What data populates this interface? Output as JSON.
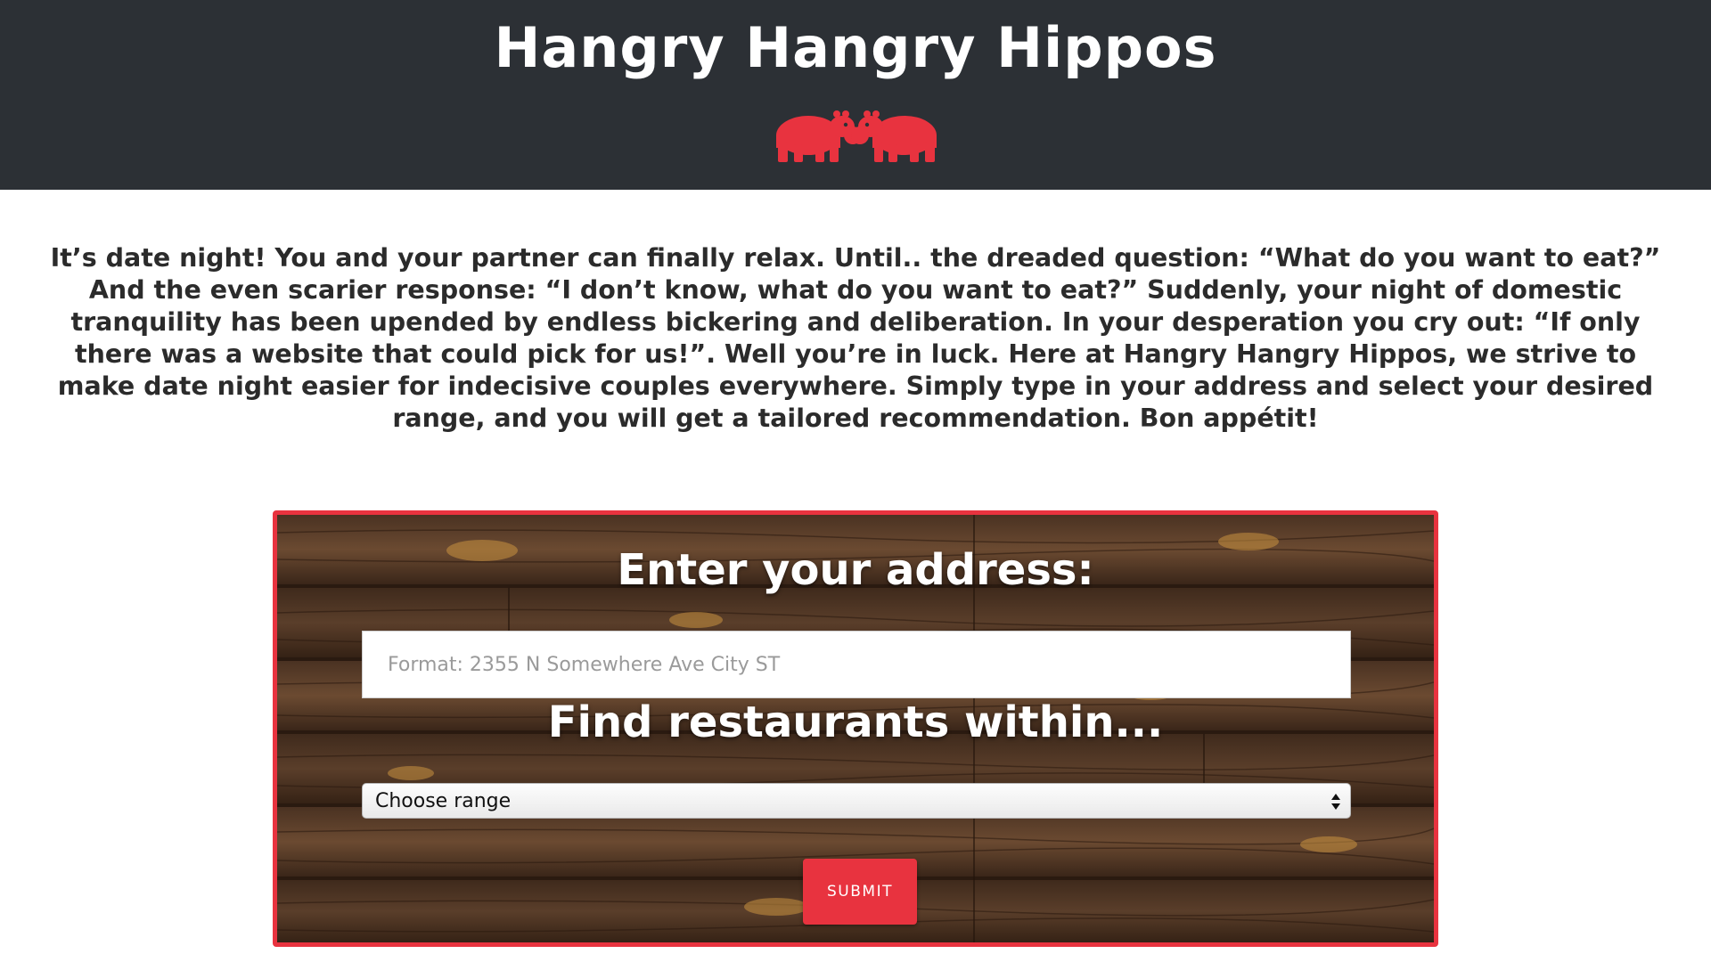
{
  "header": {
    "title": "Hangry Hangry Hippos",
    "logo_icon": "two-hippos-icon",
    "background_color": "#2c3035",
    "logo_color": "#e8333f"
  },
  "intro": {
    "text": "It’s date night! You and your partner can finally relax. Until.. the dreaded question: “What do you want to eat?” And the even scarier response: “I don’t know, what do you want to eat?” Suddenly, your night of domestic tranquility has been upended by endless bickering and deliberation. In your desperation you cry out: “If only there was a website that could pick for us!”. Well you’re in luck. Here at Hangry Hangry Hippos, we strive to make date night easier for indecisive couples everywhere. Simply type in your address and select your desired range, and you will get a tailored recommendation. Bon appétit!"
  },
  "form": {
    "address_heading": "Enter your address:",
    "address_placeholder": "Format: 2355 N Somewhere Ave City ST",
    "address_value": "",
    "range_heading": "Find restaurants within...",
    "range_selected": "Choose range",
    "submit_label": "SUBMIT",
    "accent_color": "#e8333f",
    "background": "dark wood planks"
  }
}
